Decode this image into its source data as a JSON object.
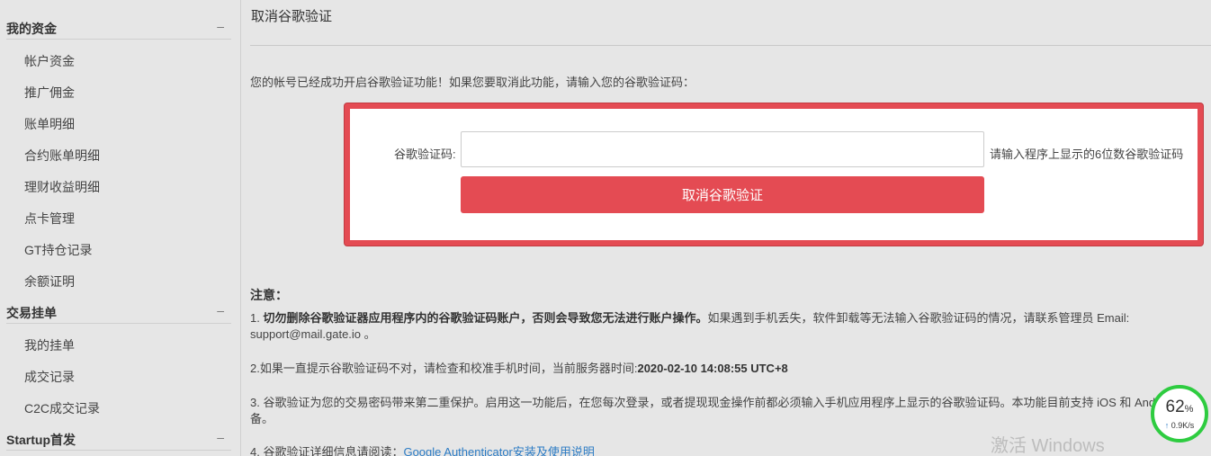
{
  "sidebar": {
    "group1": {
      "title": "我的资金",
      "toggle": "–"
    },
    "group1_items": [
      "帐户资金",
      "推广佣金",
      "账单明细",
      "合约账单明细",
      "理财收益明细",
      "点卡管理",
      "GT持仓记录",
      "余额证明"
    ],
    "group2": {
      "title": "交易挂单",
      "toggle": "–"
    },
    "group2_items": [
      "我的挂单",
      "成交记录",
      "C2C成交记录"
    ],
    "group3": {
      "title": "Startup首发",
      "toggle": "–"
    }
  },
  "main": {
    "title": "取消谷歌验证",
    "intro": "您的帐号已经成功开启谷歌验证功能！如果您要取消此功能，请输入您的谷歌验证码：",
    "form": {
      "label": "谷歌验证码:",
      "value": "",
      "placeholder": "",
      "hint": "请输入程序上显示的6位数谷歌验证码",
      "button": "取消谷歌验证"
    },
    "notes": {
      "title": "注意：",
      "n1_prefix": "1. ",
      "n1_bold": "切勿删除谷歌验证器应用程序内的谷歌验证码账户，否则会导致您无法进行账户操作。",
      "n1_rest": "如果遇到手机丢失，软件卸载等无法输入谷歌验证码的情况，请联系管理员 Email:",
      "n1_line2": "support@mail.gate.io 。",
      "n2_prefix": "2.如果一直提示谷歌验证码不对，请检查和校准手机时间，当前服务器时间:",
      "n2_time": "2020-02-10 14:08:55 UTC+8",
      "n3_line1": "3. 谷歌验证为您的交易密码带来第二重保护。启用这一功能后，在您每次登录，或者提现现金操作前都必须输入手机应用程序上显示的谷歌验证码。本功能目前支持 iOS 和 And",
      "n3_line2": "备。",
      "n4_prefix": "4. 谷歌验证详细信息请阅读：",
      "n4_link": "Google Authenticator安装及使用说明"
    }
  },
  "network_widget": {
    "percent": "62",
    "percent_unit": "%",
    "speed": "0.9K/s",
    "arrow": "↑",
    "ring_color": "#2ecc40"
  },
  "watermark": "激活 Windows",
  "colors": {
    "accent": "#e44b53",
    "link": "#2b7bc4",
    "background": "#e6e6e6"
  }
}
